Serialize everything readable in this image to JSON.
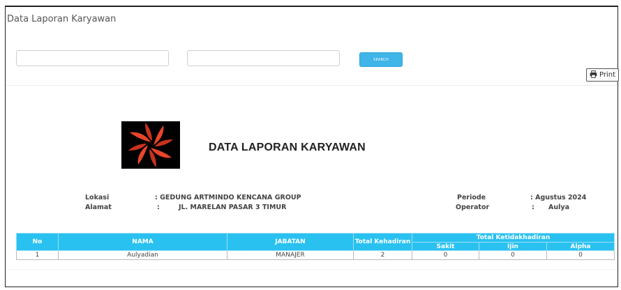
{
  "page": {
    "title": "Data Laporan Karyawan"
  },
  "filters": {
    "input1_value": "",
    "input2_value": "",
    "search_label": "SEARCH",
    "print_label": "Print"
  },
  "report": {
    "title": "DATA LAPORAN KARYAWAN",
    "lokasi_label": "Lokasi",
    "lokasi_value": ": GEDUNG ARTMINDO KENCANA GROUP",
    "alamat_label": "Alamat",
    "alamat_colon": ":",
    "alamat_value": "JL. MARELAN PASAR 3 TIMUR",
    "periode_label": "Periode",
    "periode_value": ": Agustus 2024",
    "operator_label": "Operator",
    "operator_colon": ":",
    "operator_value": "Aulya"
  },
  "table": {
    "headers": {
      "no": "No",
      "nama": "NAMA",
      "jabatan": "JABATAN",
      "total_kehadiran": "Total Kehadiran",
      "total_ketidakhadiran": "Total Ketidakhadiran",
      "sakit": "Sakit",
      "ijin": "Ijin",
      "alpha": "Alpha"
    },
    "rows": [
      {
        "no": "1",
        "nama": "Aulyadian",
        "jabatan": "MANAJER",
        "total_kehadiran": "2",
        "sakit": "0",
        "ijin": "0",
        "alpha": "0"
      }
    ]
  },
  "colors": {
    "accent": "#29c1f0",
    "logo_primary": "#e8452a",
    "logo_bg": "#000000"
  },
  "icons": {
    "print": "printer-icon",
    "logo": "company-logo"
  }
}
